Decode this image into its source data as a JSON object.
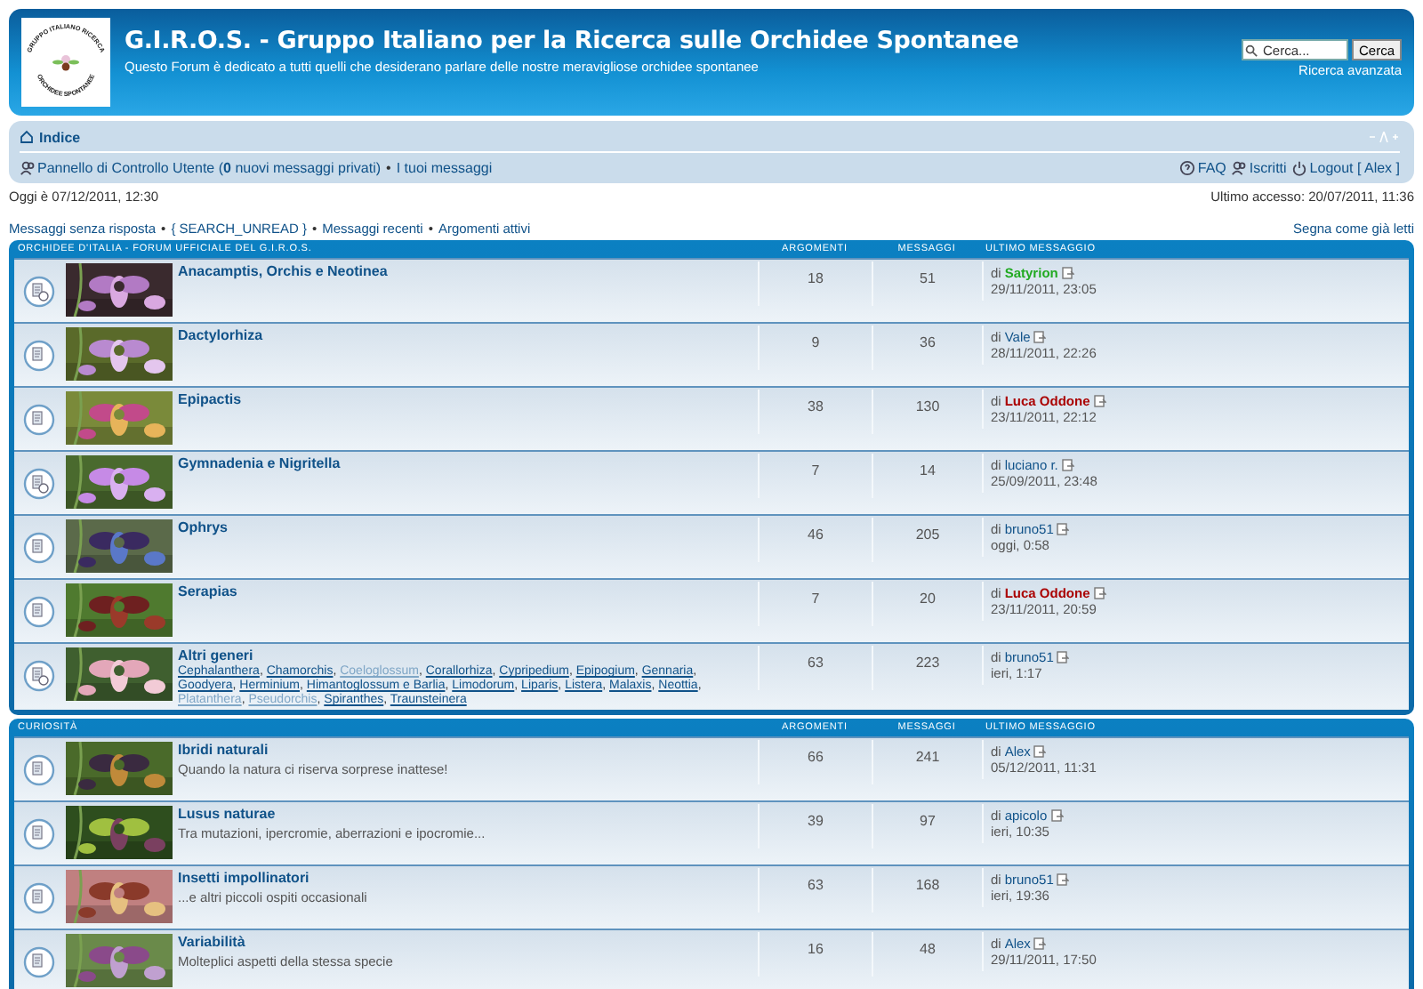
{
  "header": {
    "logo": {
      "top_text": "GRUPPO ITALIANO RICERCA",
      "bottom_text": "ORCHIDEE SPONTANEE"
    },
    "title": "G.I.R.O.S. - Gruppo Italiano per la Ricerca sulle Orchidee Spontanee",
    "subtitle": "Questo Forum è dedicato a tutti quelli che desiderano parlare delle nostre meravigliose orchidee spontanee",
    "search": {
      "placeholder": "Cerca...",
      "button": "Cerca",
      "advanced": "Ricerca avanzata"
    }
  },
  "navbar": {
    "breadcrumb": "Indice",
    "user_panel": "Pannello di Controllo Utente (**0** nuovi messaggi privati)",
    "separator": "•",
    "my_posts": "I tuoi messaggi",
    "right_links": [
      {
        "kind": "faq",
        "label": "FAQ"
      },
      {
        "kind": "members",
        "label": "Iscritti"
      },
      {
        "kind": "logout",
        "label": "Logout [ Alex ]"
      }
    ]
  },
  "info": {
    "today": "Oggi è 07/12/2011, 12:30",
    "last_visit": "Ultimo accesso: 20/07/2011, 11:36"
  },
  "quick_links": {
    "items": [
      "Messaggi senza risposta",
      "{ SEARCH_UNREAD }",
      "Messaggi recenti",
      "Argomenti attivi"
    ],
    "separator": "•",
    "mark_read": "Segna come già letti"
  },
  "categories": [
    {
      "title": "ORCHIDEE D'ITALIA - FORUM UFFICIALE DEL G.I.R.O.S.",
      "columns": [
        "ARGOMENTI",
        "MESSAGGI",
        "ULTIMO MESSAGGIO"
      ],
      "forums": [
        {
          "name": "Anacamptis, Orchis e Neotinea",
          "unread": true,
          "topics": "18",
          "posts": "51",
          "last": {
            "by": "di",
            "author": "Satyrion",
            "color": "#22aa22",
            "time": "29/11/2011, 23:05"
          }
        },
        {
          "name": "Dactylorhiza",
          "unread": false,
          "topics": "9",
          "posts": "36",
          "last": {
            "by": "di",
            "author": "Vale",
            "time": "28/11/2011, 22:26"
          }
        },
        {
          "name": "Epipactis",
          "unread": false,
          "topics": "38",
          "posts": "130",
          "last": {
            "by": "di",
            "author": "Luca Oddone",
            "color": "#aa0000",
            "time": "23/11/2011, 22:12"
          }
        },
        {
          "name": "Gymnadenia e Nigritella",
          "unread": true,
          "topics": "7",
          "posts": "14",
          "last": {
            "by": "di",
            "author": "luciano r.",
            "time": "25/09/2011, 23:48"
          }
        },
        {
          "name": "Ophrys",
          "unread": false,
          "topics": "46",
          "posts": "205",
          "last": {
            "by": "di",
            "author": "bruno51",
            "time": "oggi, 0:58"
          }
        },
        {
          "name": "Serapias",
          "unread": false,
          "topics": "7",
          "posts": "20",
          "last": {
            "by": "di",
            "author": "Luca Oddone",
            "color": "#aa0000",
            "time": "23/11/2011, 20:59"
          }
        },
        {
          "name": "Altri generi",
          "unread": true,
          "subforum_separator": ",",
          "topics": "63",
          "posts": "223",
          "last": {
            "by": "di",
            "author": "bruno51",
            "time": "ieri, 1:17"
          },
          "subforums": [
            {
              "name": "Cephalanthera",
              "muted": false
            },
            {
              "name": "Chamorchis",
              "muted": false
            },
            {
              "name": "Coeloglossum",
              "muted": true
            },
            {
              "name": "Corallorhiza",
              "muted": false
            },
            {
              "name": "Cypripedium",
              "muted": false
            },
            {
              "name": "Epipogium",
              "muted": false
            },
            {
              "name": "Gennaria",
              "muted": false
            },
            {
              "name": "Goodyera",
              "muted": false
            },
            {
              "name": "Herminium",
              "muted": false
            },
            {
              "name": "Himantoglossum e Barlia",
              "muted": false
            },
            {
              "name": "Limodorum",
              "muted": false
            },
            {
              "name": "Liparis",
              "muted": false
            },
            {
              "name": "Listera",
              "muted": false
            },
            {
              "name": "Malaxis",
              "muted": false
            },
            {
              "name": "Neottia",
              "muted": false
            },
            {
              "name": "Platanthera",
              "muted": true
            },
            {
              "name": "Pseudorchis",
              "muted": true
            },
            {
              "name": "Spiranthes",
              "muted": false
            },
            {
              "name": "Traunsteinera",
              "muted": false
            }
          ]
        }
      ]
    },
    {
      "title": "CURIOSITÀ",
      "columns": [
        "ARGOMENTI",
        "MESSAGGI",
        "ULTIMO MESSAGGIO"
      ],
      "forums": [
        {
          "name": "Ibridi naturali",
          "description": "Quando la natura ci riserva sorprese inattese!",
          "unread": false,
          "topics": "66",
          "posts": "241",
          "last": {
            "by": "di",
            "author": "Alex",
            "time": "05/12/2011, 11:31"
          }
        },
        {
          "name": "Lusus naturae",
          "description": "Tra mutazioni, ipercromie, aberrazioni e ipocromie...",
          "unread": false,
          "topics": "39",
          "posts": "97",
          "last": {
            "by": "di",
            "author": "apicolo",
            "time": "ieri, 10:35"
          }
        },
        {
          "name": "Insetti impollinatori",
          "description": "...e altri piccoli ospiti occasionali",
          "unread": false,
          "topics": "63",
          "posts": "168",
          "last": {
            "by": "di",
            "author": "bruno51",
            "time": "ieri, 19:36"
          }
        },
        {
          "name": "Variabilità",
          "description": "Molteplici aspetti della stessa specie",
          "unread": false,
          "topics": "16",
          "posts": "48",
          "last": {
            "by": "di",
            "author": "Alex",
            "time": "29/11/2011, 17:50"
          }
        }
      ]
    }
  ]
}
